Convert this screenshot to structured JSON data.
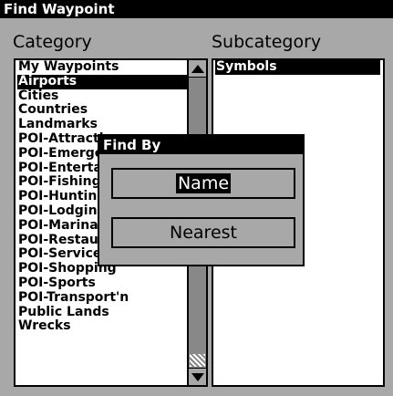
{
  "window": {
    "title": "Find Waypoint"
  },
  "headers": {
    "category": "Category",
    "subcategory": "Subcategory"
  },
  "category_list": {
    "items": [
      {
        "label": "My Waypoints",
        "selected": false
      },
      {
        "label": "Airports",
        "selected": true
      },
      {
        "label": "Cities",
        "selected": false
      },
      {
        "label": "Countries",
        "selected": false
      },
      {
        "label": "Landmarks",
        "selected": false
      },
      {
        "label": "POI-Attractions",
        "selected": false
      },
      {
        "label": "POI-Emergency",
        "selected": false
      },
      {
        "label": "POI-Entertainment",
        "selected": false
      },
      {
        "label": "POI-Fishing",
        "selected": false
      },
      {
        "label": "POI-Hunting",
        "selected": false
      },
      {
        "label": "POI-Lodging",
        "selected": false
      },
      {
        "label": "POI-Marinas",
        "selected": false
      },
      {
        "label": "POI-Restaurants",
        "selected": false
      },
      {
        "label": "POI-Services",
        "selected": false
      },
      {
        "label": "POI-Shopping",
        "selected": false
      },
      {
        "label": "POI-Sports",
        "selected": false
      },
      {
        "label": "POI-Transport'n",
        "selected": false
      },
      {
        "label": "Public Lands",
        "selected": false
      },
      {
        "label": "Wrecks",
        "selected": false
      }
    ]
  },
  "subcategory_list": {
    "items": [
      {
        "label": "Symbols",
        "selected": true
      }
    ]
  },
  "find_by_dialog": {
    "title": "Find By",
    "name_label": "Name",
    "nearest_label": "Nearest"
  },
  "colors": {
    "background": "#a8a8a8",
    "selection": "#000000",
    "list_bg": "#ffffff"
  }
}
